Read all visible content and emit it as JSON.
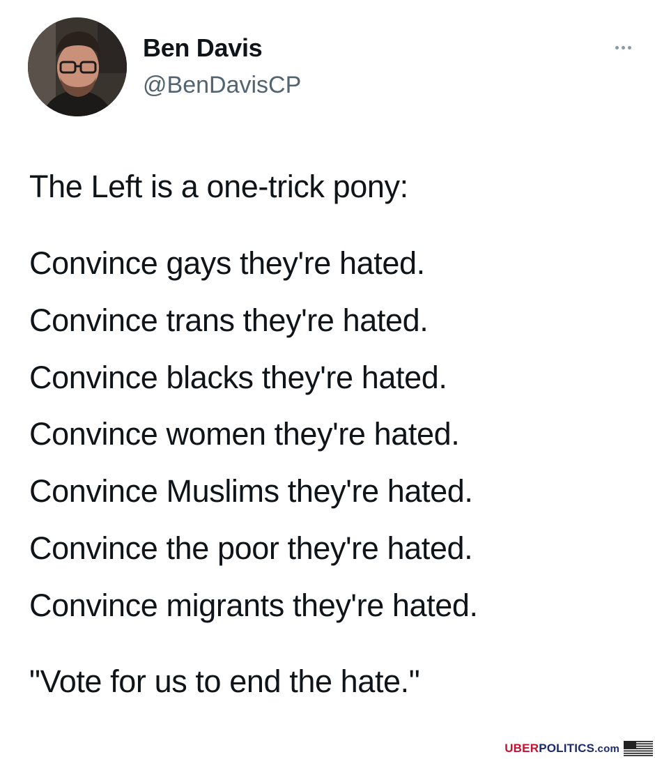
{
  "author": {
    "display_name": "Ben Davis",
    "handle": "@BenDavisCP",
    "avatar_icon": "profile-photo-man-with-glasses"
  },
  "menu_icon": "more-options-icon",
  "tweet": {
    "intro": "The Left is a one-trick pony:",
    "lines": [
      "Convince gays they're hated.",
      "Convince trans they're hated.",
      "Convince blacks they're hated.",
      "Convince women they're hated.",
      "Convince Muslims they're hated.",
      "Convince the poor they're hated.",
      "Convince migrants they're hated."
    ],
    "closing": "\"Vote for us to end the hate.\""
  },
  "watermark": {
    "part1": "UBER",
    "part2": "POLITICS",
    "part3": ".com",
    "flag_icon": "us-flag-icon",
    "colors": {
      "red": "#c8102e",
      "blue": "#1a2a6c"
    }
  }
}
